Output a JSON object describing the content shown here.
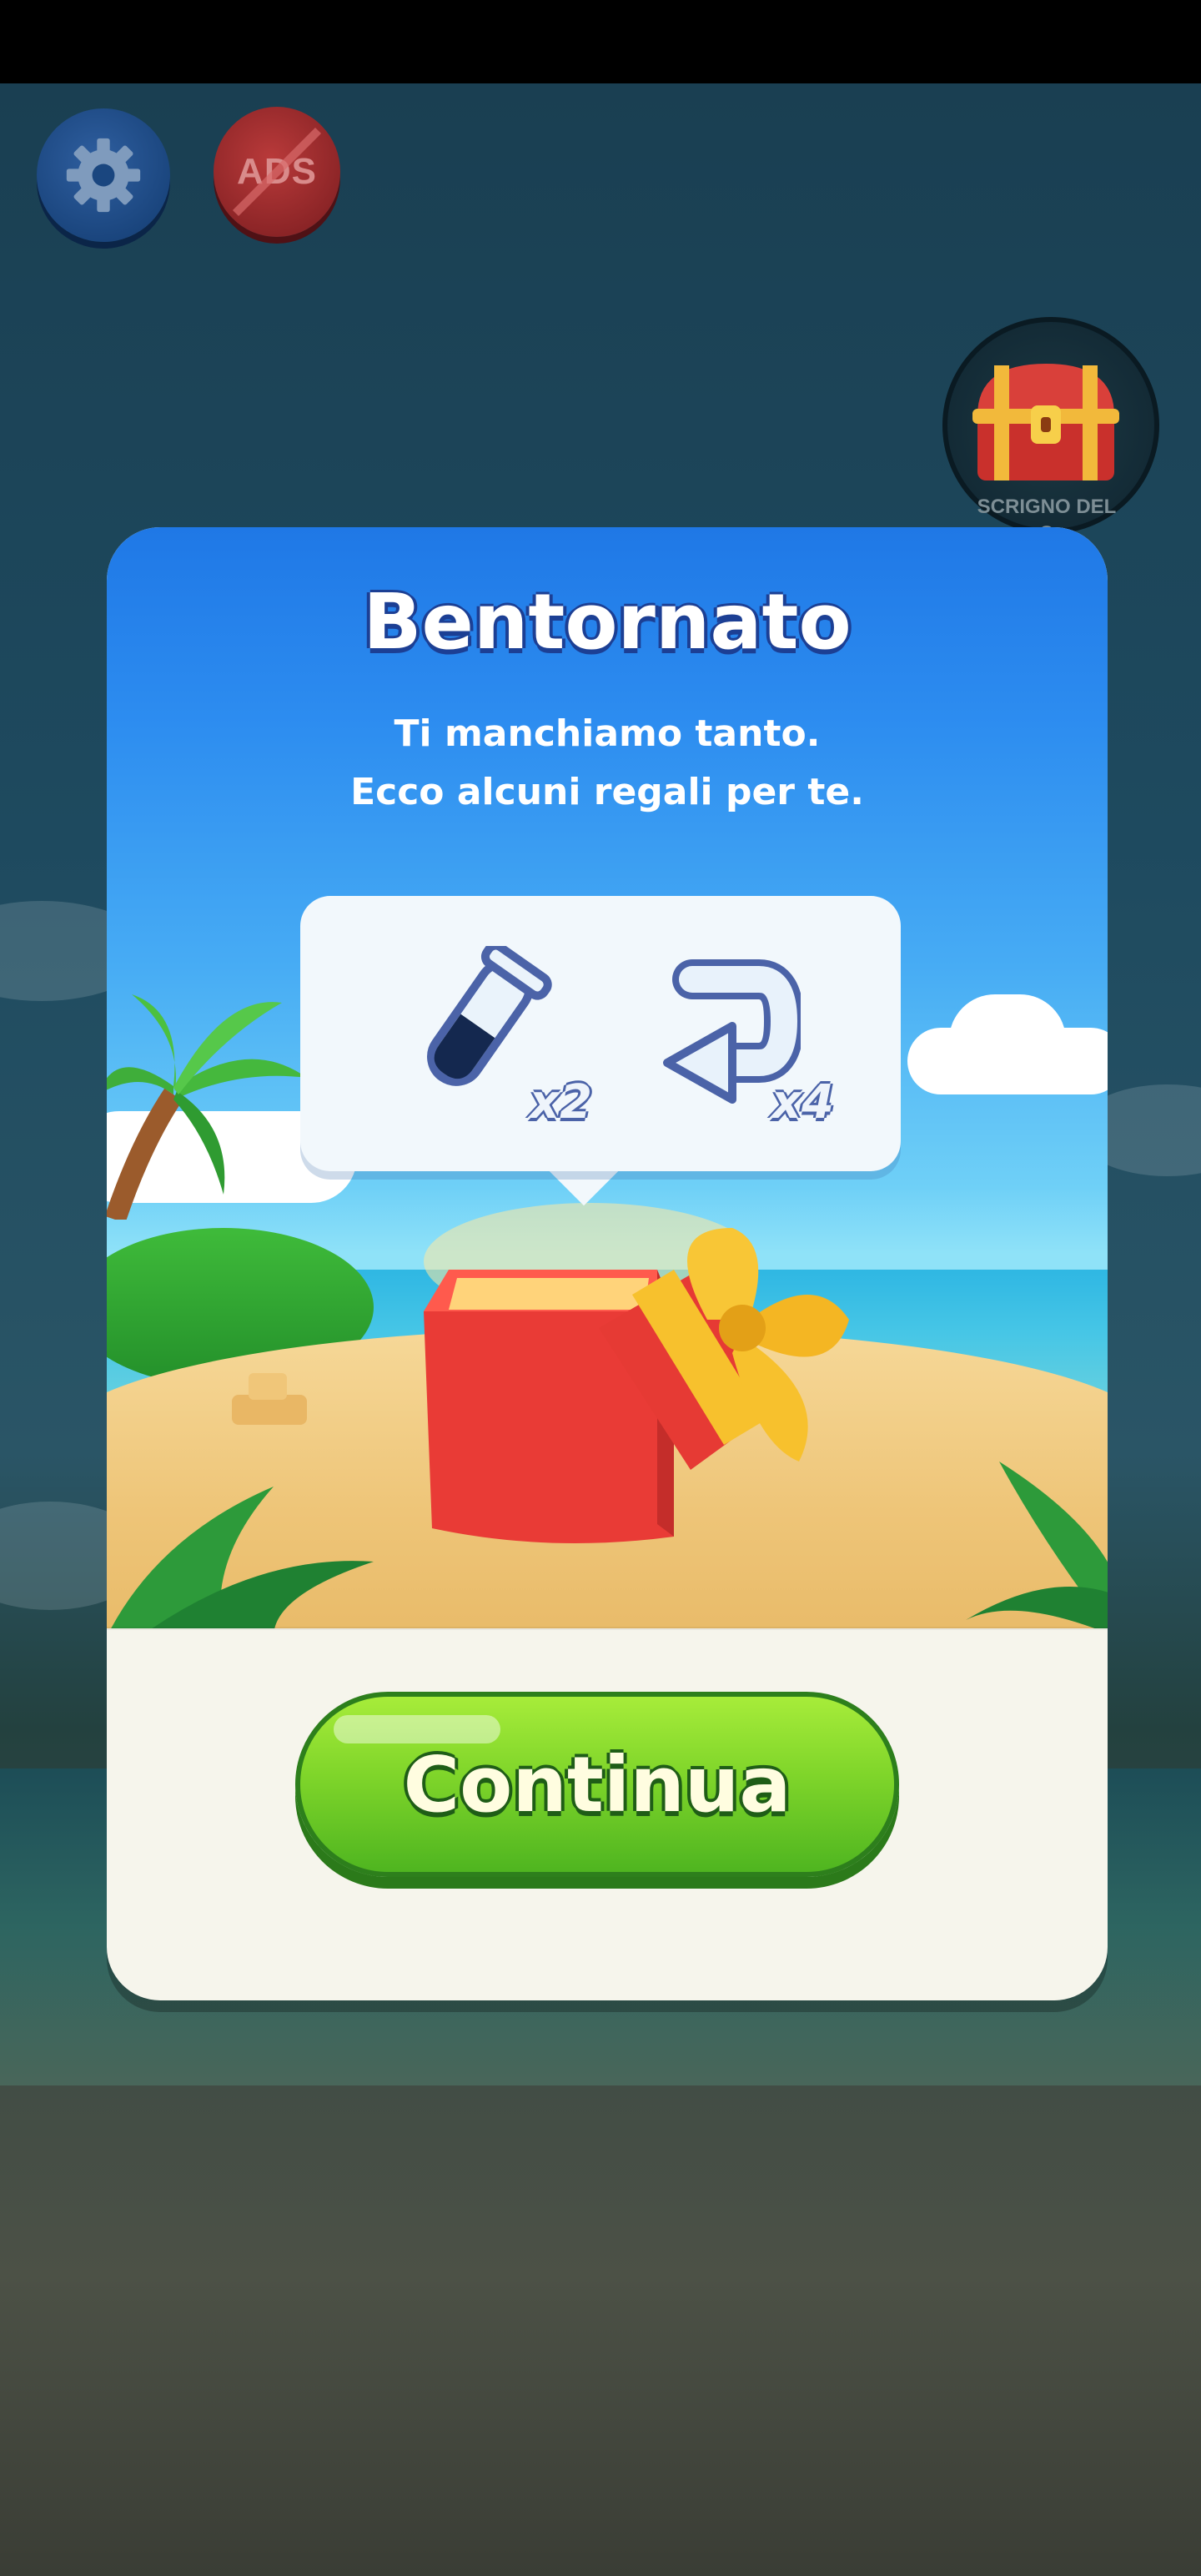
{
  "hud": {
    "settings_icon": "gear-icon",
    "ads_label": "ADS",
    "chest_label_line1": "SCRIGNO DEL",
    "chest_label_line2": "O"
  },
  "dialog": {
    "title": "Bentornato",
    "subtitle_line1": "Ti manchiamo tanto.",
    "subtitle_line2": "Ecco alcuni regali per te.",
    "rewards": [
      {
        "icon": "test-tube-icon",
        "quantity": "x2"
      },
      {
        "icon": "undo-arrow-icon",
        "quantity": "x4"
      }
    ],
    "continue_label": "Continua"
  },
  "colors": {
    "title_stroke": "#1c3f94",
    "button_green": "#7fd52a",
    "panel_bg": "#f6f5ec"
  }
}
